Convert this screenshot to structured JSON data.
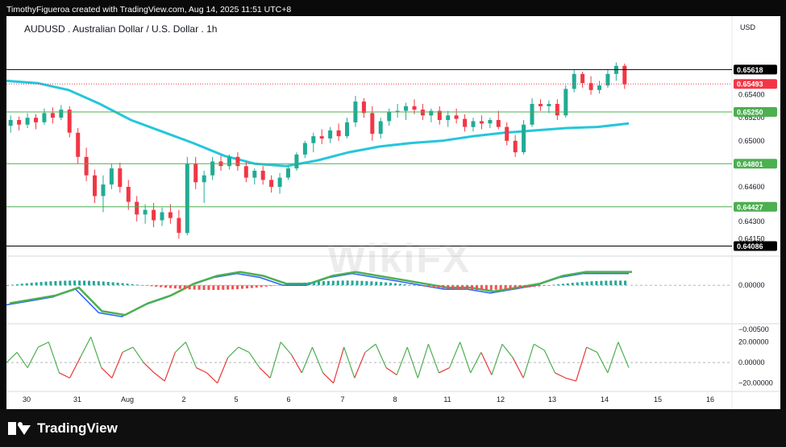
{
  "header": {
    "credit": "TimothyFigueroa created with TradingView.com, Aug 14, 2025 11:51 UTC+8",
    "title": "AUDUSD . Australian Dollar / U.S. Dollar . 1h",
    "currency": "USD",
    "watermark": "WikiFX"
  },
  "footer": {
    "brand": "TradingView"
  },
  "colors": {
    "up": "#22ab94",
    "down": "#f23645",
    "ma": "#26c6da",
    "macd_signal": "#2962ff",
    "rsi_up": "#4caf50",
    "rsi_down": "#e53935",
    "histo_up": "#26a69a",
    "histo_down": "#ef5350"
  },
  "chart_data": [
    {
      "type": "candlestick",
      "title": "AUDUSD . Australian Dollar / U.S. Dollar . 1h",
      "x_tick_labels": [
        "30",
        "31",
        "Aug",
        "2",
        "5",
        "6",
        "7",
        "8",
        "11",
        "12",
        "13",
        "14",
        "15",
        "16"
      ],
      "y_tick_labels": [
        "0.65400",
        "0.65200",
        "0.65000",
        "0.64600",
        "0.64300",
        "0.64150"
      ],
      "ylim": [
        0.6402,
        0.659
      ],
      "price_levels": [
        {
          "label": "0.65618",
          "value": 0.65618,
          "color": "#000000",
          "style": "solid"
        },
        {
          "label": "0.65493",
          "value": 0.65493,
          "color": "#f23645",
          "style": "dotted"
        },
        {
          "label": "0.65250",
          "value": 0.6525,
          "color": "#4caf50",
          "style": "solid"
        },
        {
          "label": "0.64801",
          "value": 0.64801,
          "color": "#4caf50",
          "style": "solid"
        },
        {
          "label": "0.64427",
          "value": 0.64427,
          "color": "#4caf50",
          "style": "solid"
        },
        {
          "label": "0.64086",
          "value": 0.64086,
          "color": "#000000",
          "style": "solid"
        }
      ],
      "close_path": [
        0.6518,
        0.6515,
        0.652,
        0.6516,
        0.6522,
        0.6524,
        0.6527,
        0.652,
        0.6505,
        0.649,
        0.647,
        0.646,
        0.6445,
        0.6435,
        0.6445,
        0.646,
        0.647,
        0.6465,
        0.645,
        0.644,
        0.6432,
        0.6428,
        0.6435,
        0.643,
        0.6436,
        0.6433,
        0.644,
        0.642,
        0.6475,
        0.6482,
        0.6472,
        0.646,
        0.647,
        0.6482,
        0.6486,
        0.6484,
        0.6487,
        0.6478,
        0.647,
        0.6478,
        0.6473,
        0.647,
        0.6476,
        0.6466,
        0.646,
        0.647,
        0.6474,
        0.648,
        0.649,
        0.6496,
        0.6501,
        0.6508,
        0.6505,
        0.6511,
        0.6514,
        0.6509,
        0.6518,
        0.6531,
        0.6528,
        0.652,
        0.6507,
        0.6512,
        0.6526,
        0.652,
        0.6527,
        0.6531,
        0.6528,
        0.6524,
        0.6529,
        0.6521,
        0.6525,
        0.6518,
        0.6528,
        0.6521,
        0.6517,
        0.6512,
        0.6515,
        0.6518,
        0.6516,
        0.6521,
        0.652,
        0.6519,
        0.651,
        0.65,
        0.6492,
        0.6516,
        0.653,
        0.6534,
        0.6528,
        0.6526,
        0.6533,
        0.6548,
        0.6557,
        0.6551,
        0.6546,
        0.6552,
        0.6548,
        0.656
      ],
      "ma_path": [
        0.6552,
        0.655,
        0.6544,
        0.6532,
        0.6518,
        0.6508,
        0.6498,
        0.6487,
        0.648,
        0.6478,
        0.6483,
        0.649,
        0.6495,
        0.6498,
        0.65,
        0.6504,
        0.6507,
        0.6509,
        0.6511,
        0.6512,
        0.6515
      ],
      "macd_ylim": [
        -0.0009,
        0.0006
      ],
      "macd_ticks": [
        "0.00000",
        "−0.00500"
      ],
      "macd_line": [
        -0.0005,
        -0.0004,
        -0.0003,
        -0.0001,
        -0.0007,
        -0.0008,
        -0.0005,
        -0.0003,
        0.0,
        0.0002,
        0.0003,
        0.0002,
        0.0,
        0.0,
        0.0002,
        0.0003,
        0.0002,
        0.0001,
        0.0,
        -0.0001,
        -0.0001,
        -0.0002,
        -0.0001,
        0.0,
        0.0002,
        0.0003,
        0.0003,
        0.0003
      ],
      "rsi_ylim": [
        -25,
        30
      ],
      "rsi_ticks": [
        "20.00000",
        "0.00000",
        "−20.00000"
      ],
      "rsi_line": [
        0,
        10,
        -5,
        15,
        20,
        -10,
        -15,
        5,
        25,
        -5,
        -15,
        10,
        15,
        0,
        -10,
        -18,
        10,
        20,
        -5,
        -10,
        -20,
        5,
        15,
        10,
        -5,
        -15,
        20,
        8,
        -10,
        15,
        -10,
        -20,
        15,
        -15,
        10,
        18,
        -5,
        -12,
        15,
        -15,
        18,
        -10,
        -5,
        20,
        -10,
        10,
        -12,
        18,
        5,
        -15,
        18,
        12,
        -10,
        -15,
        -18,
        15,
        10,
        -10,
        20,
        -5
      ],
      "candles": [
        [
          0.6513,
          0.6522,
          0.6507,
          0.6518
        ],
        [
          0.6518,
          0.6521,
          0.6509,
          0.6514
        ],
        [
          0.6514,
          0.6524,
          0.6511,
          0.652
        ],
        [
          0.652,
          0.6523,
          0.651,
          0.6516
        ],
        [
          0.6516,
          0.6528,
          0.6514,
          0.6524
        ],
        [
          0.6524,
          0.6529,
          0.6515,
          0.652
        ],
        [
          0.652,
          0.6531,
          0.6518,
          0.6527
        ],
        [
          0.6527,
          0.653,
          0.6503,
          0.6507
        ],
        [
          0.6507,
          0.6511,
          0.648,
          0.6486
        ],
        [
          0.6486,
          0.6494,
          0.6465,
          0.647
        ],
        [
          0.647,
          0.6475,
          0.6446,
          0.6452
        ],
        [
          0.6452,
          0.647,
          0.6438,
          0.6462
        ],
        [
          0.6462,
          0.648,
          0.6458,
          0.6476
        ],
        [
          0.6476,
          0.6481,
          0.6455,
          0.646
        ],
        [
          0.646,
          0.6466,
          0.644,
          0.6447
        ],
        [
          0.6447,
          0.6452,
          0.643,
          0.6436
        ],
        [
          0.6436,
          0.6445,
          0.6428,
          0.644
        ],
        [
          0.644,
          0.6446,
          0.6425,
          0.6431
        ],
        [
          0.6431,
          0.6442,
          0.6426,
          0.6438
        ],
        [
          0.6438,
          0.6445,
          0.6428,
          0.6433
        ],
        [
          0.6433,
          0.644,
          0.6415,
          0.642
        ],
        [
          0.642,
          0.6486,
          0.6418,
          0.648
        ],
        [
          0.648,
          0.6486,
          0.6458,
          0.6464
        ],
        [
          0.6464,
          0.6474,
          0.6446,
          0.647
        ],
        [
          0.647,
          0.6486,
          0.6466,
          0.6482
        ],
        [
          0.6482,
          0.6487,
          0.6474,
          0.6478
        ],
        [
          0.6478,
          0.6488,
          0.6475,
          0.6486
        ],
        [
          0.6486,
          0.649,
          0.6474,
          0.6478
        ],
        [
          0.6478,
          0.6482,
          0.6464,
          0.6468
        ],
        [
          0.6468,
          0.6476,
          0.6462,
          0.6474
        ],
        [
          0.6474,
          0.6478,
          0.6462,
          0.6466
        ],
        [
          0.6466,
          0.647,
          0.6455,
          0.646
        ],
        [
          0.646,
          0.6472,
          0.6454,
          0.6468
        ],
        [
          0.6468,
          0.6478,
          0.6466,
          0.6476
        ],
        [
          0.6476,
          0.649,
          0.6474,
          0.6488
        ],
        [
          0.6488,
          0.65,
          0.6485,
          0.6498
        ],
        [
          0.6498,
          0.6507,
          0.649,
          0.6504
        ],
        [
          0.6504,
          0.651,
          0.6497,
          0.6502
        ],
        [
          0.6502,
          0.6512,
          0.6498,
          0.6509
        ],
        [
          0.6509,
          0.6515,
          0.65,
          0.6504
        ],
        [
          0.6504,
          0.652,
          0.6502,
          0.6516
        ],
        [
          0.6516,
          0.6539,
          0.6512,
          0.6534
        ],
        [
          0.6534,
          0.6537,
          0.652,
          0.6524
        ],
        [
          0.6524,
          0.653,
          0.65,
          0.6506
        ],
        [
          0.6506,
          0.652,
          0.6502,
          0.6517
        ],
        [
          0.6517,
          0.6528,
          0.6513,
          0.6525
        ],
        [
          0.6525,
          0.6532,
          0.652,
          0.6526
        ],
        [
          0.6526,
          0.6533,
          0.6518,
          0.653
        ],
        [
          0.653,
          0.6536,
          0.6523,
          0.6527
        ],
        [
          0.6527,
          0.6532,
          0.6518,
          0.6522
        ],
        [
          0.6522,
          0.6528,
          0.6516,
          0.6526
        ],
        [
          0.6526,
          0.653,
          0.6514,
          0.6518
        ],
        [
          0.6518,
          0.6526,
          0.6512,
          0.6522
        ],
        [
          0.6522,
          0.6528,
          0.6515,
          0.6519
        ],
        [
          0.6519,
          0.6523,
          0.6508,
          0.6512
        ],
        [
          0.6512,
          0.652,
          0.6508,
          0.6517
        ],
        [
          0.6517,
          0.6522,
          0.651,
          0.6515
        ],
        [
          0.6515,
          0.652,
          0.6511,
          0.6518
        ],
        [
          0.6518,
          0.6526,
          0.651,
          0.6512
        ],
        [
          0.6512,
          0.6516,
          0.6496,
          0.65
        ],
        [
          0.65,
          0.6505,
          0.6486,
          0.649
        ],
        [
          0.649,
          0.6518,
          0.6488,
          0.6514
        ],
        [
          0.6514,
          0.6537,
          0.6512,
          0.6532
        ],
        [
          0.6532,
          0.6536,
          0.6526,
          0.653
        ],
        [
          0.653,
          0.6535,
          0.6524,
          0.6532
        ],
        [
          0.6532,
          0.6536,
          0.6518,
          0.6522
        ],
        [
          0.6522,
          0.6548,
          0.652,
          0.6545
        ],
        [
          0.6545,
          0.6562,
          0.6542,
          0.6558
        ],
        [
          0.6558,
          0.656,
          0.6546,
          0.655
        ],
        [
          0.655,
          0.6556,
          0.654,
          0.6544
        ],
        [
          0.6544,
          0.6552,
          0.6541,
          0.6548
        ],
        [
          0.6548,
          0.6562,
          0.6546,
          0.6558
        ],
        [
          0.6558,
          0.6568,
          0.6552,
          0.6565
        ],
        [
          0.6565,
          0.6567,
          0.6545,
          0.6549
        ]
      ]
    }
  ]
}
